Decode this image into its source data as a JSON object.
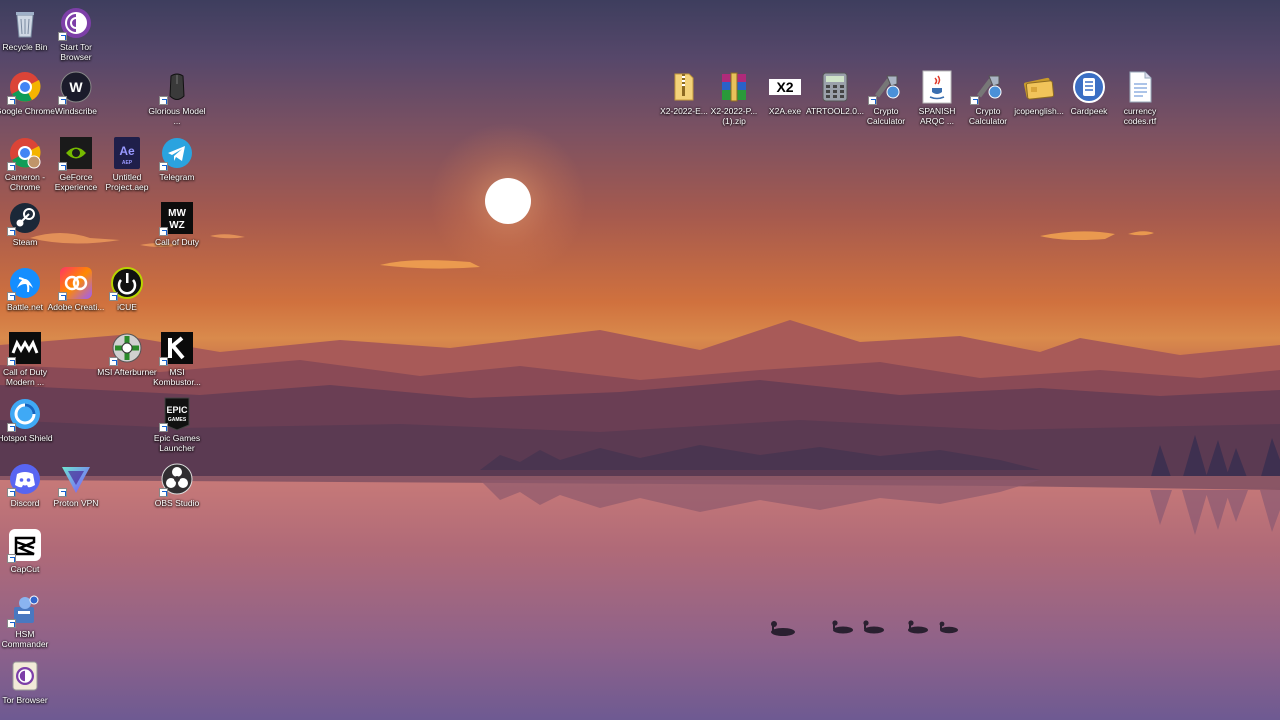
{
  "desktop": {
    "left_icons": [
      {
        "id": "recycle-bin",
        "label": "Recycle Bin",
        "icon": "recycle-bin-icon",
        "shortcut": false
      },
      {
        "id": "start-tor-browser",
        "label": "Start Tor Browser",
        "icon": "tor-browser-icon",
        "shortcut": true
      },
      {
        "id": "google-chrome",
        "label": "Google Chrome",
        "icon": "chrome-icon",
        "shortcut": true
      },
      {
        "id": "windscribe",
        "label": "Windscribe",
        "icon": "windscribe-icon",
        "shortcut": true
      },
      {
        "id": "glorious-model",
        "label": "Glorious Model ...",
        "icon": "mouse-icon",
        "shortcut": true
      },
      {
        "id": "cameron-chrome",
        "label": "Cameron - Chrome",
        "icon": "chrome-icon",
        "shortcut": true
      },
      {
        "id": "geforce-experience",
        "label": "GeForce Experience",
        "icon": "nvidia-icon",
        "shortcut": true
      },
      {
        "id": "untitled-project",
        "label": "Untitled Project.aep",
        "icon": "after-effects-icon",
        "shortcut": false
      },
      {
        "id": "telegram",
        "label": "Telegram",
        "icon": "telegram-icon",
        "shortcut": true
      },
      {
        "id": "steam",
        "label": "Steam",
        "icon": "steam-icon",
        "shortcut": true
      },
      {
        "id": "call-of-duty",
        "label": "Call of Duty",
        "icon": "mw-wz-icon",
        "shortcut": true
      },
      {
        "id": "battlenet",
        "label": "Battle.net",
        "icon": "battlenet-icon",
        "shortcut": true
      },
      {
        "id": "adobe-creative",
        "label": "Adobe Creati...",
        "icon": "adobe-cc-icon",
        "shortcut": true
      },
      {
        "id": "icue",
        "label": "iCUE",
        "icon": "icue-icon",
        "shortcut": true
      },
      {
        "id": "cod-modern",
        "label": "Call of Duty Modern ...",
        "icon": "mw-icon",
        "shortcut": true
      },
      {
        "id": "msi-afterburner",
        "label": "MSI Afterburner",
        "icon": "afterburner-icon",
        "shortcut": true
      },
      {
        "id": "msi-kombustor",
        "label": "MSI Kombustor...",
        "icon": "kombustor-icon",
        "shortcut": true
      },
      {
        "id": "hotspot-shield",
        "label": "Hotspot Shield",
        "icon": "hotspot-shield-icon",
        "shortcut": true
      },
      {
        "id": "epic-games",
        "label": "Epic Games Launcher",
        "icon": "epic-games-icon",
        "shortcut": true
      },
      {
        "id": "discord",
        "label": "Discord",
        "icon": "discord-icon",
        "shortcut": true
      },
      {
        "id": "proton-vpn",
        "label": "Proton VPN",
        "icon": "proton-vpn-icon",
        "shortcut": true
      },
      {
        "id": "obs-studio",
        "label": "OBS Studio",
        "icon": "obs-icon",
        "shortcut": true
      },
      {
        "id": "capcut",
        "label": "CapCut",
        "icon": "capcut-icon",
        "shortcut": true
      },
      {
        "id": "hsm-commander",
        "label": "HSM Commander",
        "icon": "hsm-icon",
        "shortcut": true
      },
      {
        "id": "tor-browser",
        "label": "Tor Browser",
        "icon": "tor-browser-icon",
        "shortcut": false
      }
    ],
    "top_icons": [
      {
        "id": "x2-2022-e",
        "label": "X2-2022-E...",
        "icon": "folder-zip-icon",
        "shortcut": false
      },
      {
        "id": "x2-2022-p",
        "label": "X2-2022-P... (1).zip",
        "icon": "winrar-icon",
        "shortcut": false
      },
      {
        "id": "x2a-exe",
        "label": "X2A.exe",
        "icon": "x2-icon",
        "shortcut": false
      },
      {
        "id": "atrtool",
        "label": "ATRTOOL2.0...",
        "icon": "calculator-icon",
        "shortcut": false
      },
      {
        "id": "crypto-calc-1",
        "label": "Crypto Calculator",
        "icon": "crypto-tool-icon",
        "shortcut": true
      },
      {
        "id": "spanish-arqc",
        "label": "SPANISH ARQC ...",
        "icon": "java-icon",
        "shortcut": false
      },
      {
        "id": "crypto-calc-2",
        "label": "Crypto Calculator",
        "icon": "crypto-tool-icon",
        "shortcut": true
      },
      {
        "id": "jcopenglish",
        "label": "jcopenglish...",
        "icon": "card-icon",
        "shortcut": false
      },
      {
        "id": "cardpeek",
        "label": "Cardpeek",
        "icon": "cardpeek-icon",
        "shortcut": false
      },
      {
        "id": "currency-codes",
        "label": "currency codes.rtf",
        "icon": "document-icon",
        "shortcut": false
      }
    ]
  }
}
